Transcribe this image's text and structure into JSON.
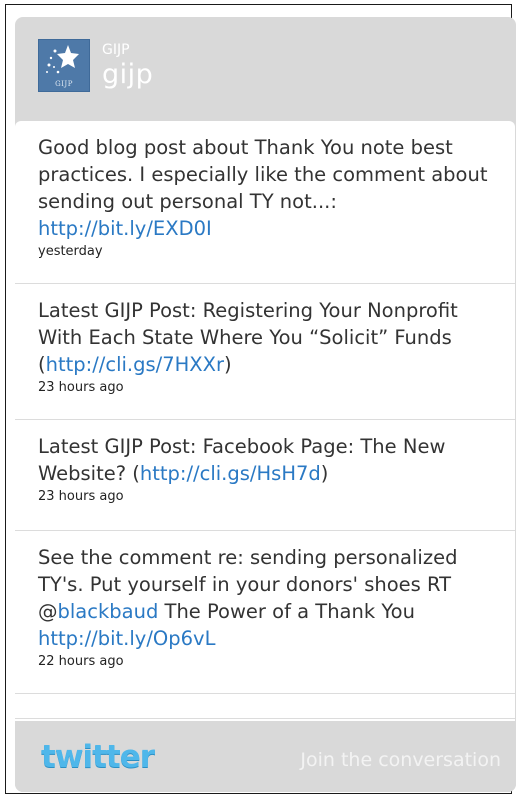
{
  "header": {
    "logo_caption": "GIJP",
    "name": "GIJP",
    "username": "gijp"
  },
  "tweets": [
    {
      "text": "Good blog post about Thank You note best practices. I especially like the comment about sending out personal TY not...: ",
      "link": "http://bit.ly/EXD0I",
      "after": "",
      "time": "yesterday"
    },
    {
      "text": "Latest GIJP Post: Registering Your Nonprofit With Each State Where You “Solicit” Funds (",
      "link": "http://cli.gs/7HXXr",
      "after": ")",
      "time": "23 hours ago"
    },
    {
      "text": "Latest GIJP Post: Facebook Page: The New Website? (",
      "link": "http://cli.gs/HsH7d",
      "after": ")",
      "time": "23 hours ago"
    },
    {
      "text": "See the comment re: sending personalized TY's. Put yourself in your donors' shoes RT @",
      "mention": "blackbaud",
      "text2": " The Power of a Thank You ",
      "link": "http://bit.ly/Op6vL",
      "time": "22 hours ago"
    }
  ],
  "footer": {
    "brand": "twitter",
    "join": "Join the conversation"
  },
  "colors": {
    "link": "#2a79c4",
    "widget_bg": "#d9d9d9",
    "logo_bg": "#4e79a8",
    "twitter_blue": "#4fb7ea"
  }
}
